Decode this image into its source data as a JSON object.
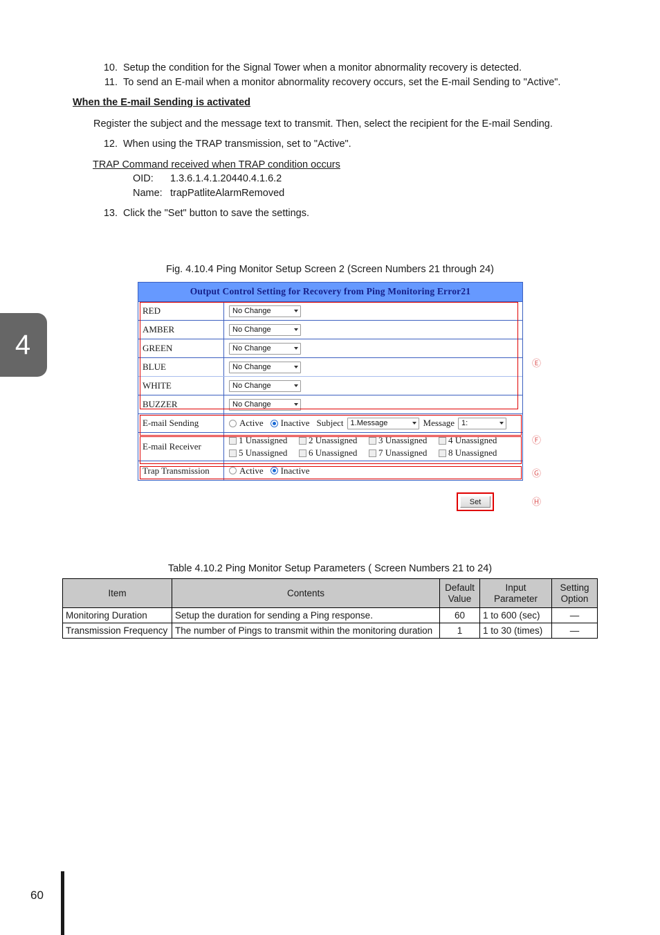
{
  "chapter_tab": {
    "number": "4"
  },
  "body": {
    "item_10": {
      "marker": "10.",
      "text": "Setup the condition for the Signal Tower when a monitor abnormality recovery is detected."
    },
    "item_11": {
      "marker": "11.",
      "text": "To send an E-mail when a monitor abnormality recovery occurs, set the E-mail Sending to \"Active\"."
    },
    "heading_email": "When the E-mail Sending is activated",
    "para_register": "Register the subject and the message text to transmit.  Then, select the recipient for the E-mail Sending.",
    "item_12": {
      "marker": "12.",
      "text": "When using the TRAP transmission, set to \"Active\"."
    },
    "trap_heading": "TRAP Command received when TRAP condition occurs",
    "trap_oid_key": "OID:",
    "trap_oid_val": "1.3.6.1.4.1.20440.4.1.6.2",
    "trap_name_key": "Name:",
    "trap_name_val": "trapPatliteAlarmRemoved",
    "item_13": {
      "marker": "13.",
      "text": "Click the \"Set\" button to save the settings."
    }
  },
  "figure": {
    "caption": "Fig. 4.10.4 Ping Monitor Setup Screen 2 (Screen Numbers 21 through 24)",
    "screen": {
      "title": "Output Control Setting for Recovery from Ping Monitoring Error21",
      "dropdown_value": "No Change",
      "color_rows": [
        {
          "label": "RED",
          "value": "No Change"
        },
        {
          "label": "AMBER",
          "value": "No Change"
        },
        {
          "label": "GREEN",
          "value": "No Change"
        },
        {
          "label": "BLUE",
          "value": "No Change"
        },
        {
          "label": "WHITE",
          "value": "No Change"
        },
        {
          "label": "BUZZER",
          "value": "No Change"
        }
      ],
      "email_sending": {
        "label": "E-mail Sending",
        "radio_active": "Active",
        "radio_inactive": "Inactive",
        "selected": "Inactive",
        "subject_label": "Subject",
        "subject_value": "1.Message",
        "message_label": "Message",
        "message_value": "1:"
      },
      "email_receiver": {
        "label": "E-mail Receiver",
        "checkboxes": [
          "1 Unassigned",
          "2 Unassigned",
          "3 Unassigned",
          "4 Unassigned",
          "5 Unassigned",
          "6 Unassigned",
          "7 Unassigned",
          "8 Unassigned"
        ]
      },
      "trap_transmission": {
        "label": "Trap Transmission",
        "radio_active": "Active",
        "radio_inactive": "Inactive",
        "selected": "Inactive"
      },
      "set_button": "Set",
      "callouts": [
        "Ⓔ",
        "Ⓕ",
        "Ⓖ",
        "Ⓗ"
      ],
      "accent_colors": {
        "title_bg": "#6699ff",
        "title_text": "#16208a",
        "grid_line": "#3b5fc0",
        "annotation_red": "#e00000",
        "callout_red": "#e06666"
      }
    }
  },
  "table": {
    "caption": "Table 4.10.2 Ping Monitor Setup Parameters (  Screen Numbers 21 to 24)",
    "headers": [
      "Item",
      "Contents",
      "Default Value",
      "Input Parameter",
      "Setting Option"
    ],
    "headers_split": [
      {
        "l1": "Item",
        "l2": ""
      },
      {
        "l1": "Contents",
        "l2": ""
      },
      {
        "l1": "Default",
        "l2": "Value"
      },
      {
        "l1": "Input",
        "l2": "Parameter"
      },
      {
        "l1": "Setting",
        "l2": "Option"
      }
    ],
    "rows": [
      {
        "item": "Monitoring Duration",
        "contents": "Setup the duration for sending a Ping response.",
        "default": "60",
        "input": "1 to 600 (sec)",
        "setting": "—"
      },
      {
        "item": "Transmission Frequency",
        "contents": "The number of Pings to transmit within the monitoring duration",
        "default": "1",
        "input": "1 to 30 (times)",
        "setting": "—"
      }
    ],
    "header_bg": "#c9c9c9"
  },
  "footer": {
    "page_number": "60"
  }
}
